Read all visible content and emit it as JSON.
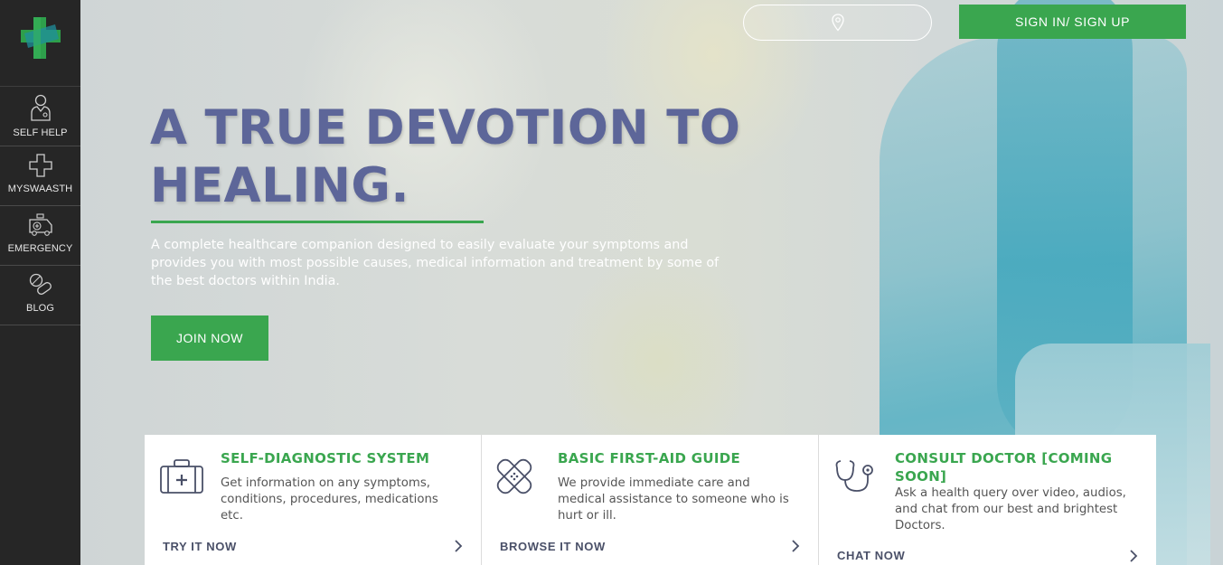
{
  "colors": {
    "brand_green": "#3aa64f",
    "headline": "#5d6699",
    "sidebar_bg": "#262626"
  },
  "sidebar": {
    "logo": "cross-logo",
    "items": [
      {
        "label": "SELF HELP",
        "icon": "doctor-icon"
      },
      {
        "label": "MYSWAASTH",
        "icon": "plus-cross-icon"
      },
      {
        "label": "EMERGENCY",
        "icon": "ambulance-icon"
      },
      {
        "label": "BLOG",
        "icon": "pills-icon"
      }
    ]
  },
  "header": {
    "location_icon": "location-pin-icon",
    "signin_label": "SIGN IN/ SIGN UP"
  },
  "hero": {
    "headline": "A TRUE DEVOTION TO HEALING.",
    "description": "A complete healthcare companion designed to easily evaluate your symptoms and provides you with most possible causes, medical information and treatment by some of the best doctors within India.",
    "cta_label": "JOIN NOW"
  },
  "features": [
    {
      "title": "SELF-DIAGNOSTIC SYSTEM",
      "text": "Get information on any symptoms, conditions, procedures, medications etc.",
      "link": "TRY IT NOW",
      "icon": "medical-kit-icon"
    },
    {
      "title": "BASIC FIRST-AID GUIDE",
      "text": "We provide immediate care and medical assistance to someone who is hurt or ill.",
      "link": "BROWSE IT NOW",
      "icon": "bandage-icon"
    },
    {
      "title": "CONSULT DOCTOR [COMING SOON]",
      "text": "Ask a health query over video, audios, and chat from our best and brightest Doctors.",
      "link": "CHAT NOW",
      "icon": "stethoscope-icon"
    }
  ]
}
